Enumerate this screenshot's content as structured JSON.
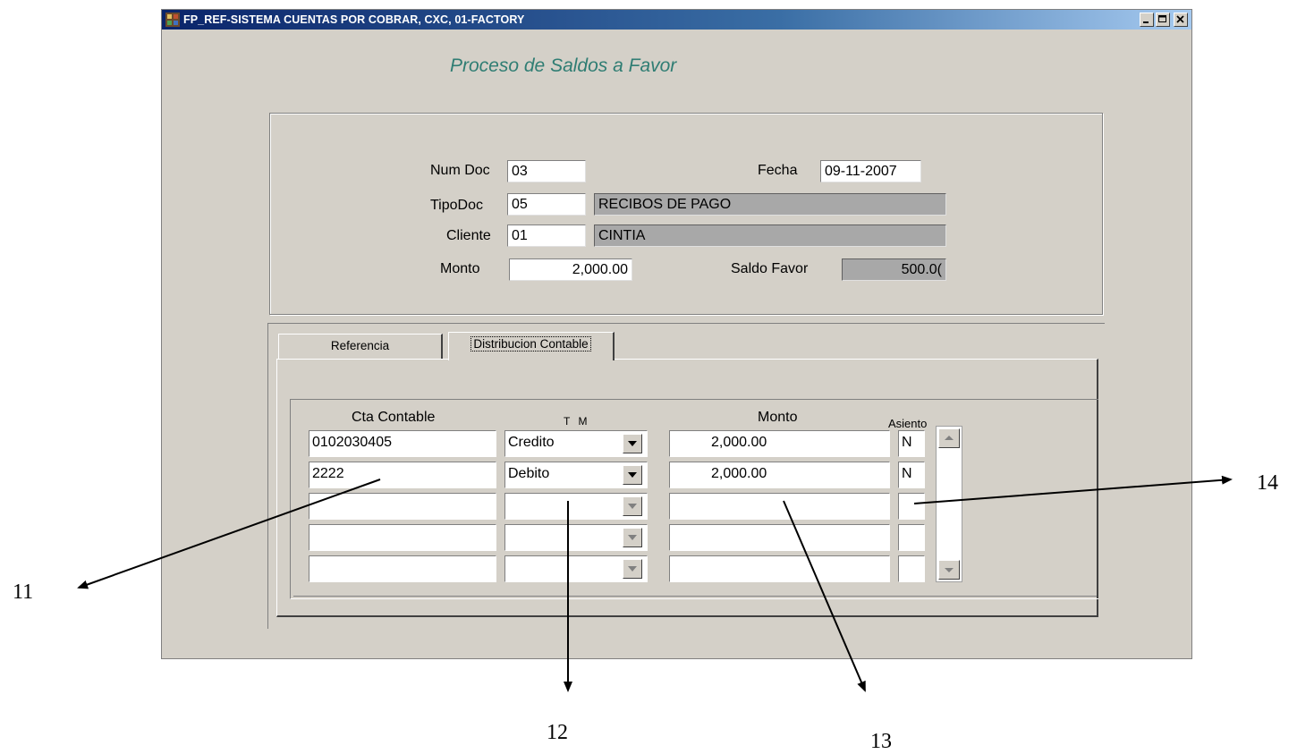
{
  "window": {
    "title": "FP_REF-SISTEMA CUENTAS POR COBRAR, CXC, 01-FACTORY",
    "controls": [
      "minimize-icon",
      "maximize-icon",
      "close-icon"
    ]
  },
  "form_title": "Proceso de Saldos a Favor",
  "header": {
    "num_doc_label": "Num Doc",
    "num_doc_value": "03",
    "fecha_label": "Fecha",
    "fecha_value": "09-11-2007",
    "tipo_doc_label": "TipoDoc",
    "tipo_doc_value": "05",
    "tipo_doc_desc": "RECIBOS DE PAGO",
    "cliente_label": "Cliente",
    "cliente_value": "01",
    "cliente_desc": "CINTIA",
    "monto_label": "Monto",
    "monto_value": "2,000.00",
    "saldo_favor_label": "Saldo Favor",
    "saldo_favor_value": "500.0("
  },
  "tabs": [
    {
      "label": "Referencia",
      "active": false
    },
    {
      "label": "Distribucion Contable",
      "active": true
    }
  ],
  "detail": {
    "columns": [
      "Cta Contable",
      "T M",
      "Monto",
      "Asiento"
    ],
    "rows": [
      {
        "cta": "0102030405",
        "tm": "Credito",
        "monto": "2,000.00",
        "asiento": "N"
      },
      {
        "cta": "2222",
        "tm": "Debito",
        "monto": "2,000.00",
        "asiento": "N"
      },
      {
        "cta": "",
        "tm": "",
        "monto": "",
        "asiento": ""
      },
      {
        "cta": "",
        "tm": "",
        "monto": "",
        "asiento": ""
      },
      {
        "cta": "",
        "tm": "",
        "monto": "",
        "asiento": ""
      }
    ]
  },
  "annotations": [
    "11",
    "12",
    "13",
    "14"
  ],
  "colors": {
    "title_bar_start": "#0a246a",
    "title_bar_end": "#a6caf0",
    "form_title": "#2f7d73",
    "window_bg": "#d4d0c8",
    "readonly_field": "#a8a8a8"
  }
}
